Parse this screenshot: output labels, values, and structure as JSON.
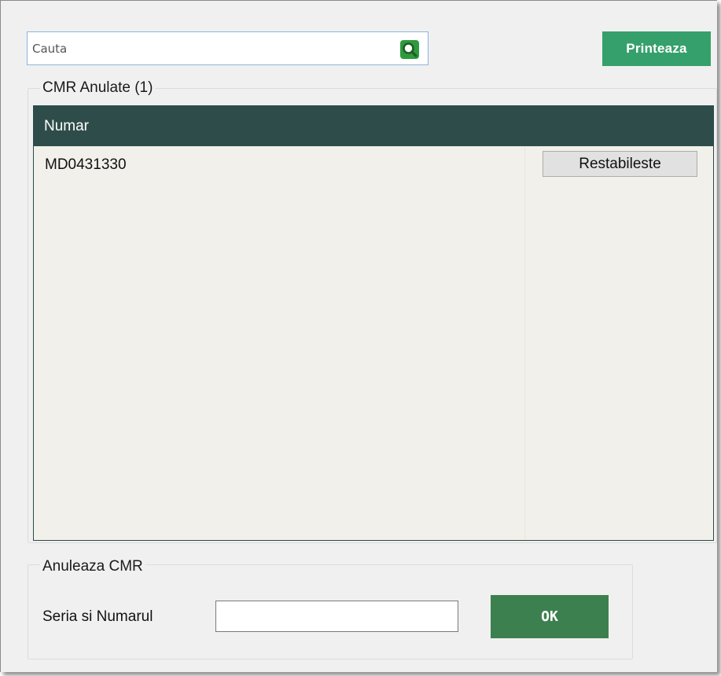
{
  "search": {
    "placeholder": "Cauta",
    "value": ""
  },
  "toolbar": {
    "print_label": "Printeaza"
  },
  "cancelled_group": {
    "title": "CMR Anulate (1)",
    "columns": [
      "Numar"
    ],
    "rows": [
      {
        "number": "MD0431330",
        "action_label": "Restabileste"
      }
    ]
  },
  "cancel_group": {
    "title": "Anuleaza CMR",
    "field_label": "Seria si Numarul",
    "field_value": "",
    "ok_label": "OK"
  },
  "colors": {
    "print_button": "#35a06b",
    "grid_header": "#2e4d4a",
    "ok_button": "#3d8050",
    "search_icon": "#2e9a3d"
  },
  "icons": {
    "search": "search-icon"
  }
}
